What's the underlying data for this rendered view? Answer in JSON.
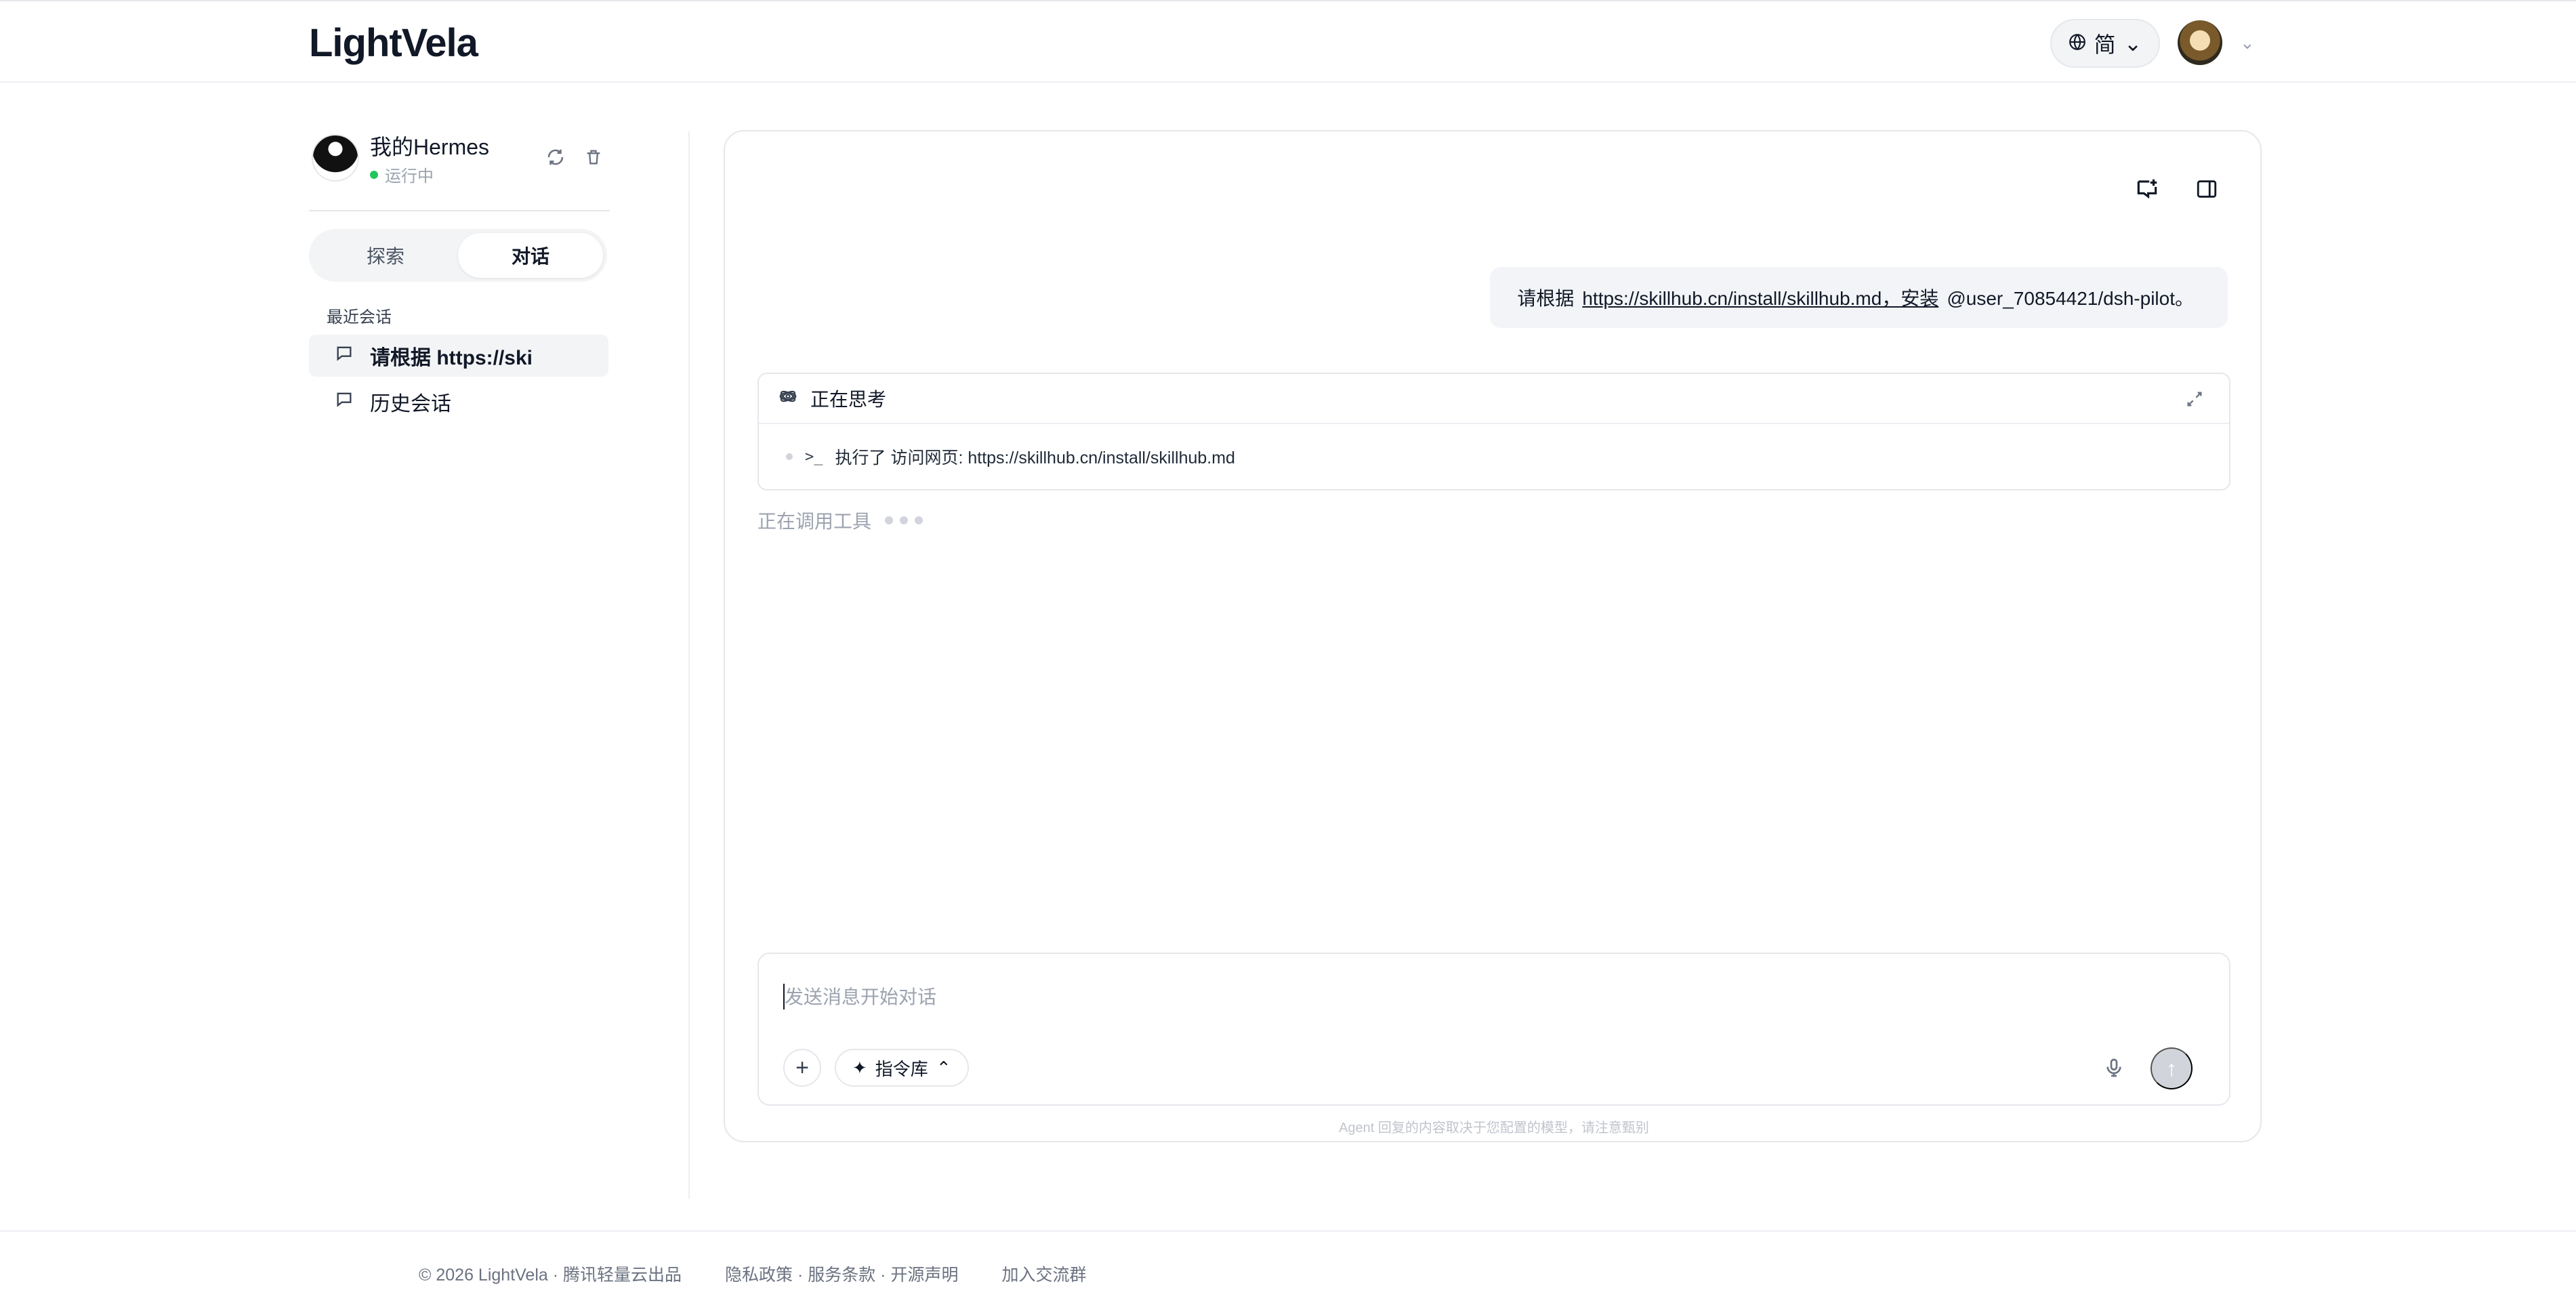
{
  "header": {
    "logo": "LightVela",
    "language": "简"
  },
  "sidebar": {
    "agent_name": "我的Hermes",
    "agent_status": "运行中",
    "tabs": [
      "探索",
      "对话"
    ],
    "recent_label": "最近会话",
    "conversations": [
      "请根据 https://ski",
      "历史会话"
    ]
  },
  "chat": {
    "user_message_prefix": "请根据",
    "user_message_link": "https://skillhub.cn/install/skillhub.md，安装",
    "user_message_suffix": "@user_70854421/dsh-pilot。",
    "thinking_title": "正在思考",
    "thinking_action": "执行了 访问网页: https://skillhub.cn/install/skillhub.md",
    "tool_status": "正在调用工具",
    "input_placeholder": "发送消息开始对话",
    "prompt_library": "指令库",
    "disclaimer": "Agent 回复的内容取决于您配置的模型，请注意甄别"
  },
  "footer": {
    "copyright": "© 2026 LightVela · 腾讯轻量云出品",
    "links": "隐私政策 · 服务条款 · 开源声明",
    "community": "加入交流群"
  },
  "colors": {
    "accent_status": "#22c55e",
    "panel_border": "#e5e7eb",
    "muted_text": "#9ca3af"
  },
  "icons": {
    "language": "globe-icon",
    "refresh": "refresh-icon",
    "delete": "trash-icon",
    "chat": "chat-bubble-icon",
    "new_chat": "new-chat-icon",
    "toggle_panel": "panel-toggle-icon",
    "thinking": "atom-icon",
    "collapse": "collapse-icon",
    "terminal": "terminal-icon",
    "add": "plus-icon",
    "sparkle": "sparkle-icon",
    "microphone": "mic-icon",
    "send": "arrow-up-icon"
  }
}
